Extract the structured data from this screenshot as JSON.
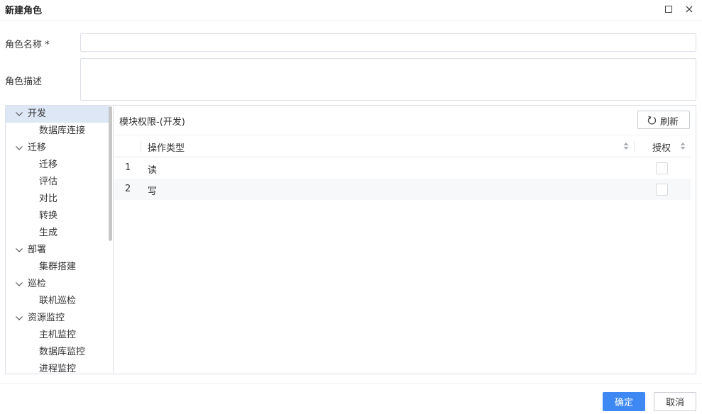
{
  "dialog": {
    "title": "新建角色"
  },
  "form": {
    "name_label": "角色名称 *",
    "name_value": "",
    "desc_label": "角色描述",
    "desc_value": ""
  },
  "tree": {
    "items": [
      {
        "label": "开发",
        "level": 0,
        "expanded": true,
        "selected": true
      },
      {
        "label": "数据库连接",
        "level": 1
      },
      {
        "label": "迁移",
        "level": 0,
        "expanded": true
      },
      {
        "label": "迁移",
        "level": 1
      },
      {
        "label": "评估",
        "level": 1
      },
      {
        "label": "对比",
        "level": 1
      },
      {
        "label": "转换",
        "level": 1
      },
      {
        "label": "生成",
        "level": 1
      },
      {
        "label": "部署",
        "level": 0,
        "expanded": true
      },
      {
        "label": "集群搭建",
        "level": 1
      },
      {
        "label": "巡检",
        "level": 0,
        "expanded": true
      },
      {
        "label": "联机巡检",
        "level": 1
      },
      {
        "label": "资源监控",
        "level": 0,
        "expanded": true
      },
      {
        "label": "主机监控",
        "level": 1
      },
      {
        "label": "数据库监控",
        "level": 1
      },
      {
        "label": "进程监控",
        "level": 1
      }
    ]
  },
  "permissions": {
    "title": "模块权限-(开发)",
    "refresh_label": "刷新",
    "columns": {
      "type": "操作类型",
      "auth": "授权"
    },
    "rows": [
      {
        "index": "1",
        "type": "读",
        "granted": false
      },
      {
        "index": "2",
        "type": "写",
        "granted": false
      }
    ]
  },
  "footer": {
    "ok_label": "确定",
    "cancel_label": "取消"
  },
  "colors": {
    "primary": "#3d88f2",
    "tree_selected": "#dde7f6",
    "border": "#dcdfe6"
  }
}
